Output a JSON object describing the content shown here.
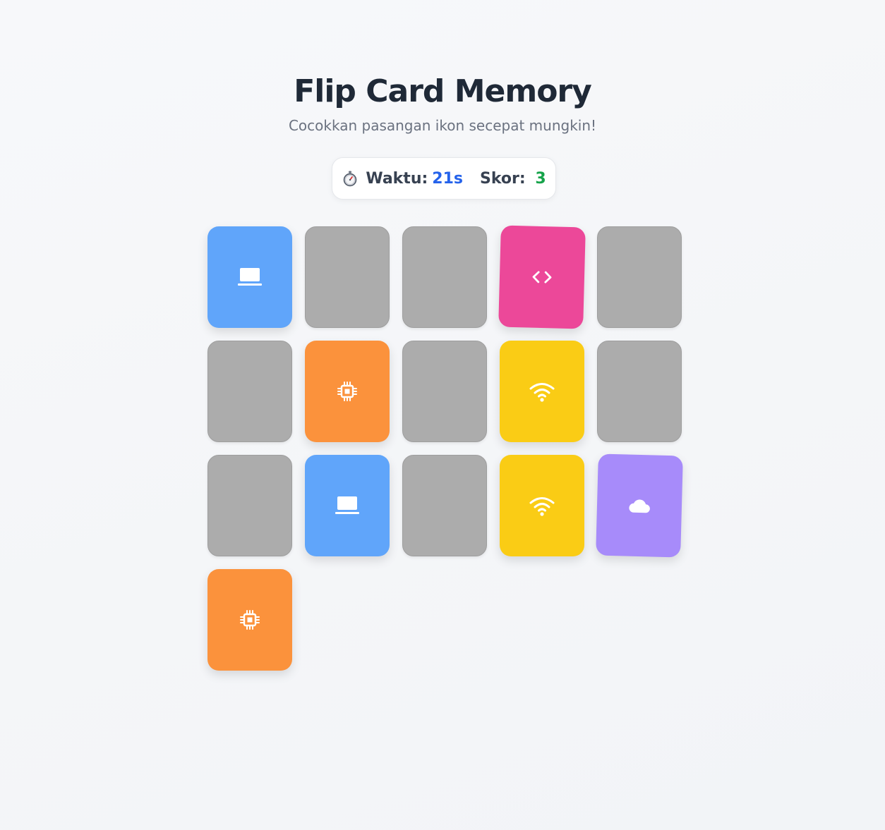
{
  "header": {
    "title": "Flip Card Memory",
    "subtitle": "Cocokkan pasangan ikon secepat mungkin!"
  },
  "stats": {
    "time_label": "Waktu:",
    "time_value": "21s",
    "score_label": "Skor:",
    "score_value": "3",
    "time_icon": "stopwatch-icon"
  },
  "colors": {
    "hidden_card": "#acacac",
    "laptop": "#60a5fa",
    "code": "#ec4899",
    "chip": "#fb923c",
    "wifi": "#facc15",
    "cloud": "#a78bfa",
    "time_value": "#2563eb",
    "score_value": "#16a34a"
  },
  "cards": [
    {
      "state": "revealed",
      "icon": "laptop-icon"
    },
    {
      "state": "hidden",
      "icon": ""
    },
    {
      "state": "hidden",
      "icon": ""
    },
    {
      "state": "revealed",
      "icon": "code-icon"
    },
    {
      "state": "hidden",
      "icon": ""
    },
    {
      "state": "hidden",
      "icon": ""
    },
    {
      "state": "revealed",
      "icon": "chip-icon"
    },
    {
      "state": "hidden",
      "icon": ""
    },
    {
      "state": "revealed",
      "icon": "wifi-icon"
    },
    {
      "state": "hidden",
      "icon": ""
    },
    {
      "state": "hidden",
      "icon": ""
    },
    {
      "state": "revealed",
      "icon": "laptop-icon"
    },
    {
      "state": "hidden",
      "icon": ""
    },
    {
      "state": "revealed",
      "icon": "wifi-icon"
    },
    {
      "state": "revealed",
      "icon": "cloud-icon"
    },
    {
      "state": "revealed",
      "icon": "chip-icon"
    }
  ]
}
